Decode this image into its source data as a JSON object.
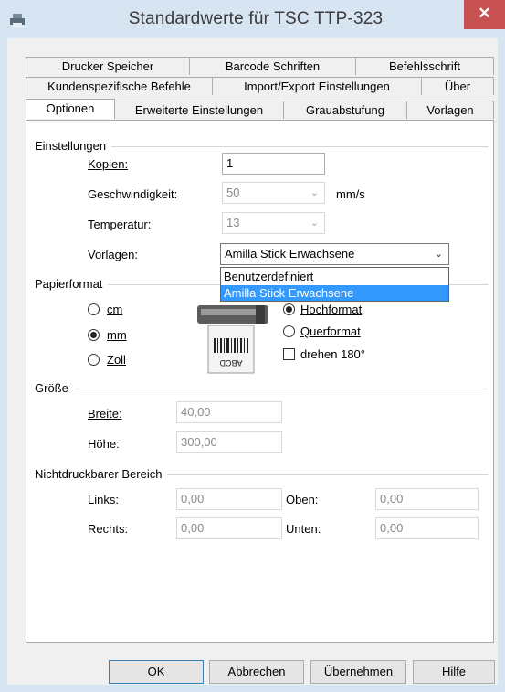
{
  "window": {
    "title": "Standardwerte für TSC TTP-323",
    "close_glyph": "✕"
  },
  "tabs": {
    "row1": [
      "Drucker Speicher",
      "Barcode Schriften",
      "Befehlsschrift"
    ],
    "row2": [
      "Kundenspezifische Befehle",
      "Import/Export Einstellungen",
      "Über"
    ],
    "row3": [
      "Optionen",
      "Erweiterte Einstellungen",
      "Grauabstufung",
      "Vorlagen"
    ],
    "active": "Optionen"
  },
  "einstellungen": {
    "heading": "Einstellungen",
    "kopien_label": "Kopien:",
    "kopien_value": "1",
    "geschwindigkeit_label": "Geschwindigkeit:",
    "geschwindigkeit_value": "50",
    "geschwindigkeit_unit": "mm/s",
    "temperatur_label": "Temperatur:",
    "temperatur_value": "13",
    "vorlagen_label": "Vorlagen:",
    "vorlagen_value": "Amilla Stick Erwachsene",
    "vorlagen_options": [
      "Benutzerdefiniert",
      "Amilla Stick Erwachsene"
    ],
    "vorlagen_selected_index": 1
  },
  "papierformat": {
    "heading": "Papierformat",
    "units": [
      {
        "label": "cm",
        "checked": false
      },
      {
        "label": "mm",
        "checked": true
      },
      {
        "label": "Zoll",
        "checked": false
      }
    ],
    "hochformat": "Hochformat",
    "querformat": "Querformat",
    "drehen": "drehen 180°",
    "preview_text": "ABCD"
  },
  "groesse": {
    "heading": "Größe",
    "breite_label": "Breite:",
    "breite_value": "40,00",
    "hoehe_label": "Höhe:",
    "hoehe_value": "300,00"
  },
  "nichtdruckbar": {
    "heading": "Nichtdruckbarer Bereich",
    "links_label": "Links:",
    "links_value": "0,00",
    "oben_label": "Oben:",
    "oben_value": "0,00",
    "rechts_label": "Rechts:",
    "rechts_value": "0,00",
    "unten_label": "Unten:",
    "unten_value": "0,00"
  },
  "buttons": {
    "ok": "OK",
    "abbrechen": "Abbrechen",
    "uebernehmen": "Übernehmen",
    "hilfe": "Hilfe"
  },
  "colors": {
    "titlebar": "#d7e4f2",
    "close": "#c75050",
    "selection": "#3399ff"
  }
}
